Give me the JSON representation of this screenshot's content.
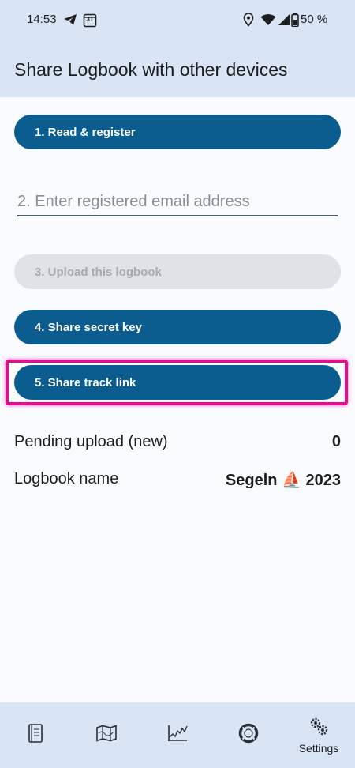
{
  "status_bar": {
    "time": "14:53",
    "calendar_day": "31",
    "battery": "50 %"
  },
  "app_bar": {
    "title": "Share Logbook with other devices"
  },
  "steps": {
    "read_register": "1. Read & register",
    "email_placeholder": "2. Enter registered email address",
    "upload": "3. Upload this logbook",
    "share_key": "4. Share secret key",
    "share_track": "5. Share track link"
  },
  "info": {
    "pending_label": "Pending upload (new)",
    "pending_value": "0",
    "name_label": "Logbook name",
    "name_value": "Segeln ⛵ 2023"
  },
  "nav": {
    "settings_label": "Settings",
    "items": [
      "logbook-icon",
      "map-icon",
      "chart-icon",
      "lifebuoy-icon",
      "settings-gears-icon"
    ]
  },
  "colors": {
    "primary": "#0b5c8f",
    "highlight": "#ea0a8c",
    "surface": "#d9e4f5",
    "disabled": "#e1e2e6"
  }
}
